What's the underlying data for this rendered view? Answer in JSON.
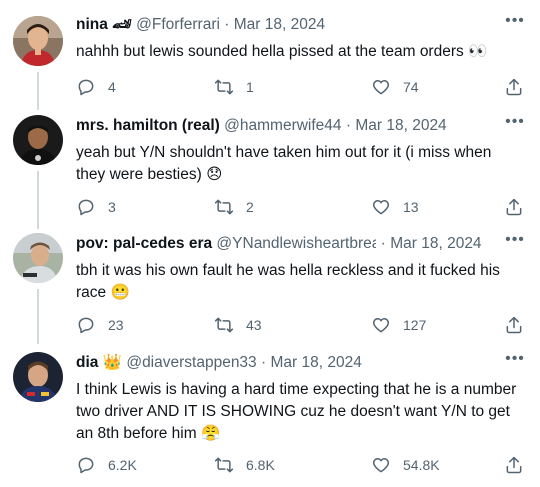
{
  "tweets": [
    {
      "name": "nina 🏎",
      "handle": "@Fforferrari",
      "date": "Mar 18, 2024",
      "text": "nahhh but lewis sounded hella pissed at the team orders 👀",
      "replies": "4",
      "retweets": "1",
      "likes": "74"
    },
    {
      "name": "mrs. hamilton (real)",
      "handle": "@hammerwife44",
      "date": "Mar 18, 2024",
      "text": "yeah but Y/N shouldn't have taken him out for it (i miss when they were besties) 😞",
      "replies": "3",
      "retweets": "2",
      "likes": "13"
    },
    {
      "name": "pov: pal-cedes era",
      "handle": "@YNandlewisheartbreak",
      "date": "Mar 18, 2024",
      "text": "tbh it was his own fault he was hella reckless and it fucked his race 😬",
      "replies": "23",
      "retweets": "43",
      "likes": "127"
    },
    {
      "name": "dia 👑",
      "handle": "@diaverstappen33",
      "date": "Mar 18, 2024",
      "text": "I think Lewis is having a hard time expecting that he is a number two driver AND IT IS SHOWING cuz he doesn't want Y/N to get an 8th before him 😤",
      "replies": "6.2K",
      "retweets": "6.8K",
      "likes": "54.8K"
    }
  ],
  "icons": {
    "reply": "reply-icon",
    "retweet": "retweet-icon",
    "like": "like-icon",
    "share": "share-icon",
    "more": "more-icon"
  },
  "colors": {
    "secondary_text": "#536471",
    "thread_line": "#cfd9de"
  }
}
